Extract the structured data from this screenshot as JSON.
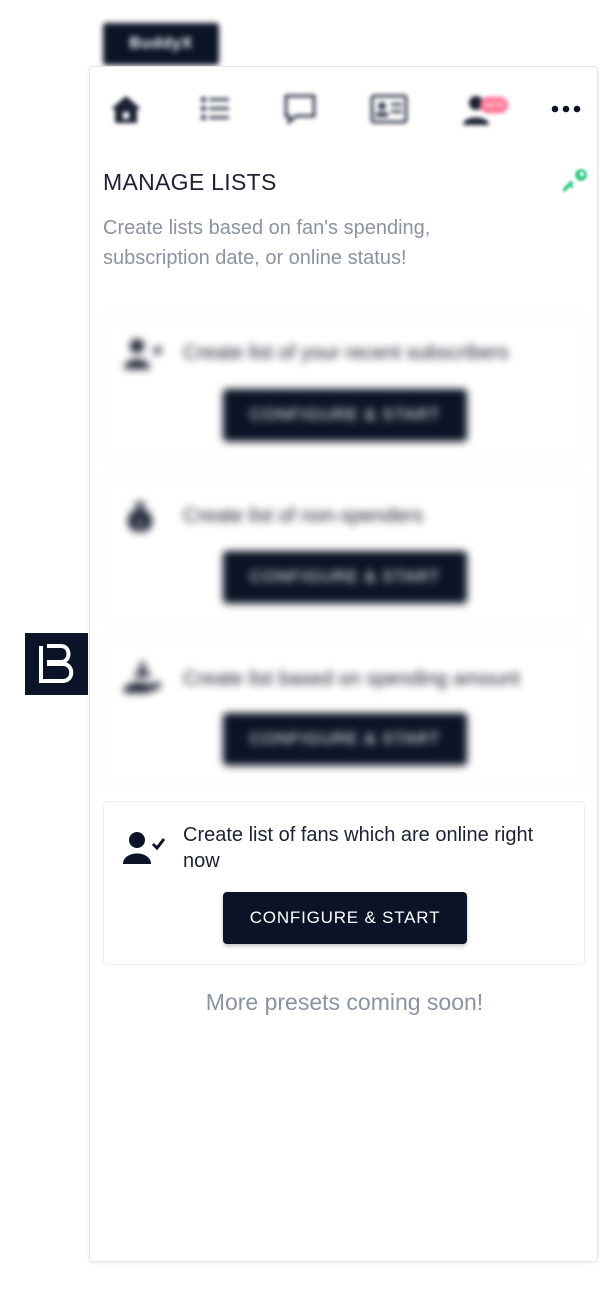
{
  "app": {
    "name": "BuddyX"
  },
  "nav": {
    "items": [
      {
        "icon": "home-icon",
        "label": "Home"
      },
      {
        "icon": "list-icon",
        "label": "Lists"
      },
      {
        "icon": "chat-icon",
        "label": "Messages"
      },
      {
        "icon": "contact-card-icon",
        "label": "Contacts"
      },
      {
        "icon": "user-new-icon",
        "label": "Fans",
        "badge": "NEW"
      }
    ],
    "more_icon": "more-dots-icon"
  },
  "page": {
    "title": "MANAGE LISTS",
    "subtitle": "Create lists based on fan's spending, subscription date, or online status!",
    "footer_note": "More presets coming soon!"
  },
  "presets": [
    {
      "icon": "user-plus-icon",
      "text": "Create list of your recent subscribers",
      "button": "CONFIGURE & START"
    },
    {
      "icon": "money-bag-icon",
      "text": "Create list of non-spenders",
      "button": "CONFIGURE & START"
    },
    {
      "icon": "hand-coin-icon",
      "text": "Create list based on spending amount",
      "button": "CONFIGURE & START"
    },
    {
      "icon": "user-check-icon",
      "text": "Create list of fans which are online right now",
      "button": "CONFIGURE & START"
    }
  ],
  "colors": {
    "primary": "#0b1426",
    "accent_key": "#3ecf8e",
    "muted_text": "#8a93a1",
    "badge": "#ff6b8a"
  }
}
